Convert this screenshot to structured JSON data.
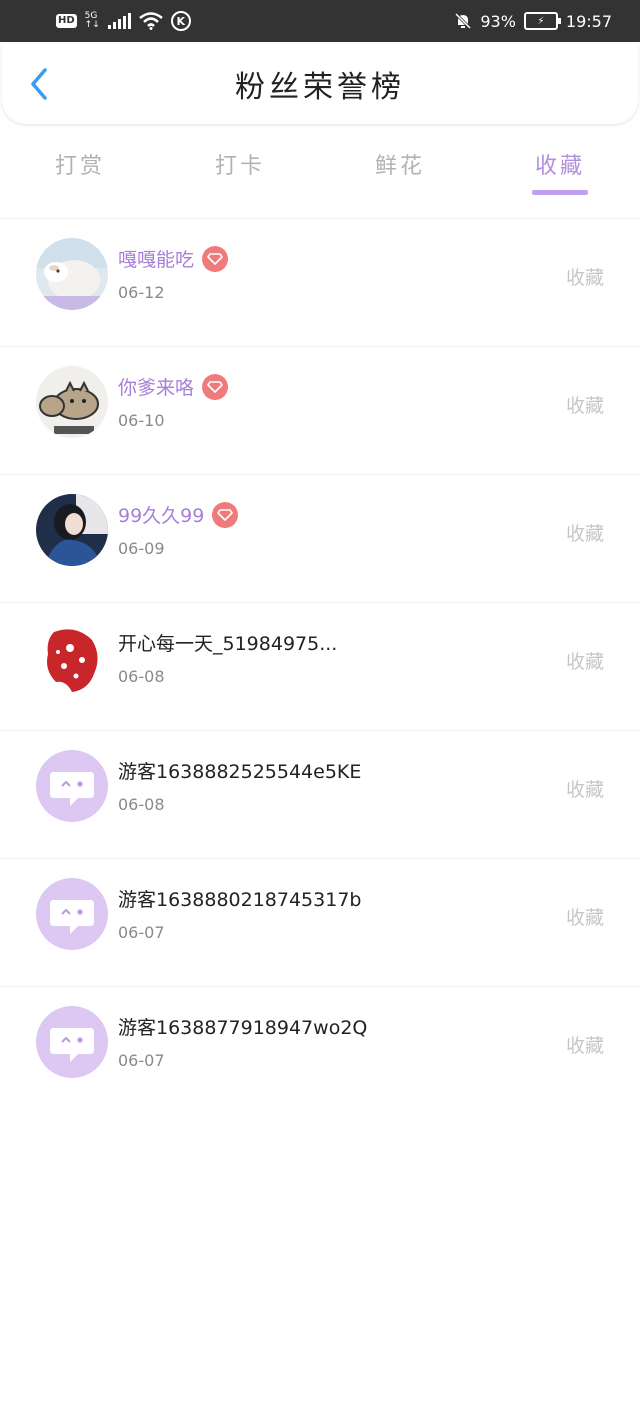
{
  "status_bar": {
    "hd": "HD",
    "network": "5G",
    "battery_percent": "93%",
    "time": "19:57"
  },
  "header": {
    "title": "粉丝荣誉榜",
    "back_icon": "chevron-left-icon"
  },
  "tabs": [
    {
      "label": "打赏",
      "active": false
    },
    {
      "label": "打卡",
      "active": false
    },
    {
      "label": "鲜花",
      "active": false
    },
    {
      "label": "收藏",
      "active": true
    }
  ],
  "list": [
    {
      "name": "嘎嘎能吃",
      "date": "06-12",
      "action": "收藏",
      "vip": true,
      "avatar": "sheep-photo"
    },
    {
      "name": "你爹来咯",
      "date": "06-10",
      "action": "收藏",
      "vip": true,
      "avatar": "cat-sticker"
    },
    {
      "name": "99久久99",
      "date": "06-09",
      "action": "收藏",
      "vip": true,
      "avatar": "girl-photo"
    },
    {
      "name": "开心每一天_51984975...",
      "date": "06-08",
      "action": "收藏",
      "vip": false,
      "avatar": "red-papercut"
    },
    {
      "name": "游客1638882525544e5KE",
      "date": "06-08",
      "action": "收藏",
      "vip": false,
      "avatar": "default-chat"
    },
    {
      "name": "游客1638880218745317b",
      "date": "06-07",
      "action": "收藏",
      "vip": false,
      "avatar": "default-chat"
    },
    {
      "name": "游客1638877918947wo2Q",
      "date": "06-07",
      "action": "收藏",
      "vip": false,
      "avatar": "default-chat"
    }
  ],
  "colors": {
    "accent": "#b48fe0",
    "vip_badge": "#f07b7b",
    "default_avatar_bg": "#dcc8f3"
  }
}
